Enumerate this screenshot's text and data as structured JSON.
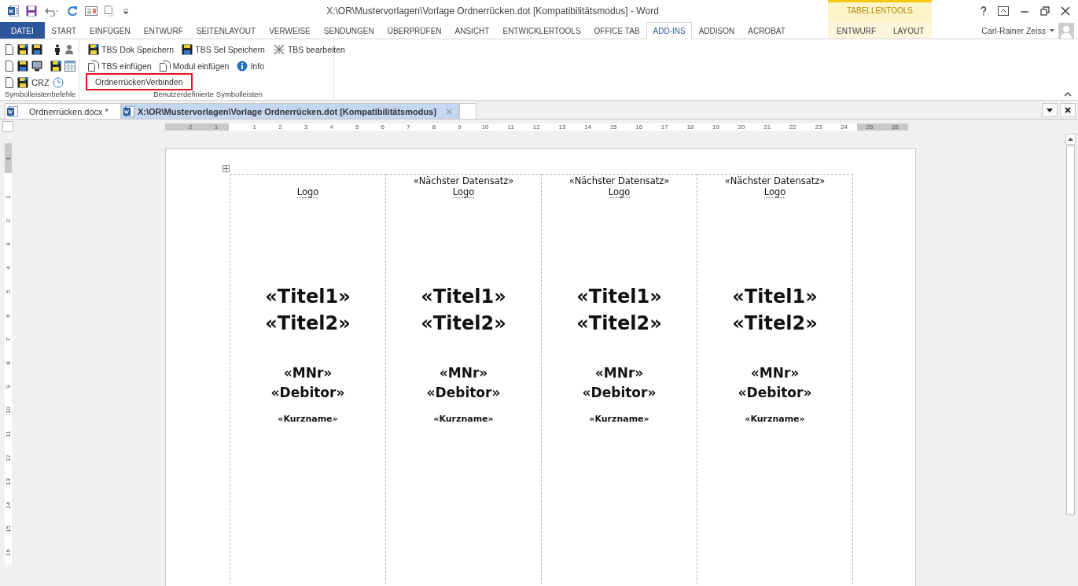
{
  "window": {
    "title": "X:\\OR\\Mustervorlagen\\Vorlage Ordnerrücken.dot [Kompatibilitätsmodus] - Word"
  },
  "ribbon_tabs": [
    {
      "label": "DATEI",
      "kind": "file",
      "selected": false
    },
    {
      "label": "START",
      "kind": "tab",
      "selected": false
    },
    {
      "label": "EINFÜGEN",
      "kind": "tab",
      "selected": false
    },
    {
      "label": "ENTWURF",
      "kind": "tab",
      "selected": false
    },
    {
      "label": "SEITENLAYOUT",
      "kind": "tab",
      "selected": false
    },
    {
      "label": "VERWEISE",
      "kind": "tab",
      "selected": false
    },
    {
      "label": "SENDUNGEN",
      "kind": "tab",
      "selected": false
    },
    {
      "label": "ÜBERPRÜFEN",
      "kind": "tab",
      "selected": false
    },
    {
      "label": "ANSICHT",
      "kind": "tab",
      "selected": false
    },
    {
      "label": "ENTWICKLERTOOLS",
      "kind": "tab",
      "selected": false
    },
    {
      "label": "OFFICE TAB",
      "kind": "tab",
      "selected": false
    },
    {
      "label": "ADD-INS",
      "kind": "tab",
      "selected": true
    },
    {
      "label": "ADDISON",
      "kind": "tab",
      "selected": false
    },
    {
      "label": "ACROBAT",
      "kind": "tab",
      "selected": false
    }
  ],
  "contextual": {
    "title": "TABELLENTOOLS",
    "tabs": [
      {
        "label": "ENTWURF",
        "selected": false
      },
      {
        "label": "LAYOUT",
        "selected": false
      }
    ]
  },
  "user": {
    "name": "Carl-Rainer Zeiss"
  },
  "ribbon": {
    "groups": [
      {
        "label": "Symbolleistenbefehle",
        "crz_label": "CRZ"
      },
      {
        "label": "Benutzerdefinierte Symbolleisten",
        "buttons": [
          {
            "label": "TBS Dok Speichern",
            "highlighted": false
          },
          {
            "label": "TBS Sel Speichern",
            "highlighted": false
          },
          {
            "label": "TBS bearbeiten",
            "highlighted": false
          },
          {
            "label": "TBS einfügen",
            "highlighted": false
          },
          {
            "label": "Modul einfügen",
            "highlighted": false
          },
          {
            "label": "Info",
            "highlighted": false
          },
          {
            "label": "OrdnerrückenVerbinden",
            "highlighted": true
          }
        ]
      }
    ]
  },
  "document_tabs": [
    {
      "label": "Ordnerrücken.docx *",
      "selected": false
    },
    {
      "label": "X:\\OR\\Mustervorlagen\\Vorlage Ordnerrücken.dot [Kompatibilitätsmodus]",
      "selected": true
    }
  ],
  "ruler": {
    "left_numbers": [
      "2",
      "1"
    ],
    "numbers": [
      "1",
      "2",
      "3",
      "4",
      "5",
      "6",
      "7",
      "8",
      "9",
      "10",
      "11",
      "12",
      "13",
      "14",
      "15",
      "16",
      "17",
      "18",
      "19",
      "20",
      "21",
      "22",
      "23",
      "24",
      "25",
      "26"
    ]
  },
  "vertical_ruler": {
    "top_numbers": [
      "1"
    ],
    "numbers": [
      "1",
      "2",
      "3",
      "4",
      "5",
      "6",
      "7",
      "8",
      "9",
      "10",
      "11",
      "12",
      "13",
      "14",
      "15",
      "16"
    ]
  },
  "table": {
    "columns": [
      {
        "logo": "Logo",
        "title1": "«Titel1»",
        "title2": "«Titel2»",
        "mnr": "«MNr»",
        "debitor": "«Debitor»",
        "short_name": "«Kurzname»"
      },
      {
        "next_record": "«Nächster Datensatz»",
        "logo": "Logo",
        "title1": "«Titel1»",
        "title2": "«Titel2»",
        "mnr": "«MNr»",
        "debitor": "«Debitor»",
        "short_name": "«Kurzname»"
      },
      {
        "next_record": "«Nächster Datensatz»",
        "logo": "Logo",
        "title1": "«Titel1»",
        "title2": "«Titel2»",
        "mnr": "«MNr»",
        "debitor": "«Debitor»",
        "short_name": "«Kurzname»"
      },
      {
        "next_record": "«Nächster Datensatz»",
        "logo": "Logo",
        "title1": "«Titel1»",
        "title2": "«Titel2»",
        "mnr": "«MNr»",
        "debitor": "«Debitor»",
        "short_name": "«Kurzname»"
      }
    ]
  }
}
